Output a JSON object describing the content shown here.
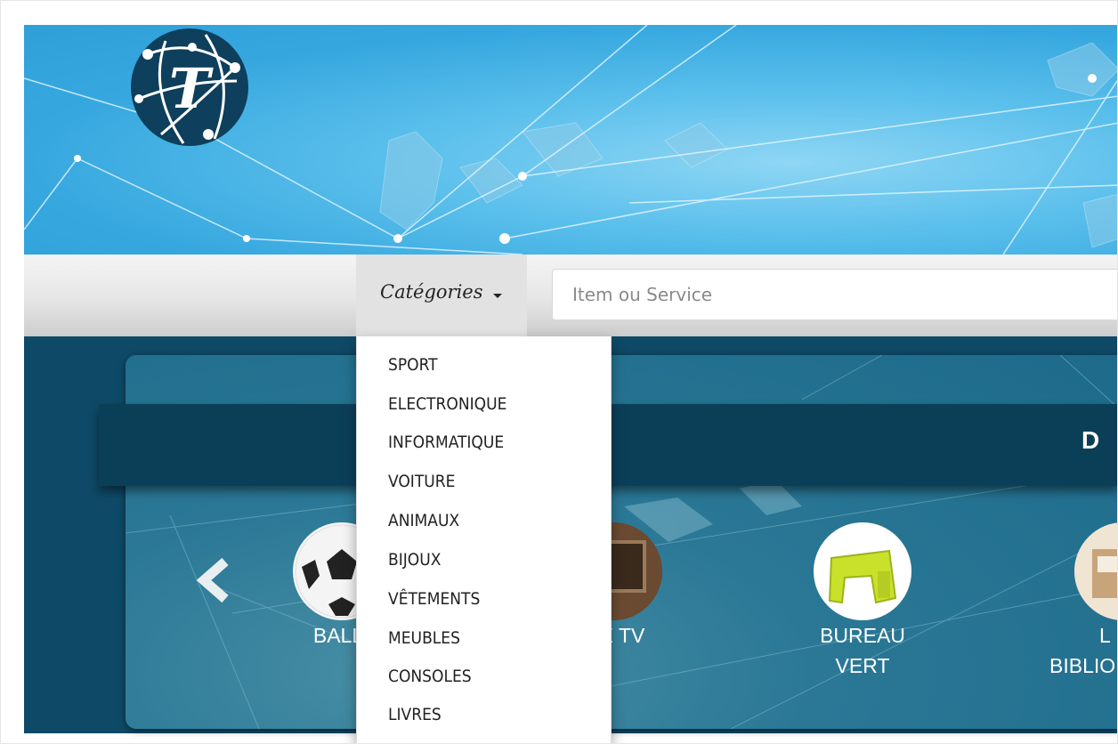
{
  "header": {
    "logo_letter": "T"
  },
  "search": {
    "categories_label": "Catégories",
    "placeholder": "Item ou Service"
  },
  "categories_menu": {
    "items": [
      "SPORT",
      "ELECTRONIQUE",
      "INFORMATIQUE",
      "VOITURE",
      "ANIMAUX",
      "BIJOUX",
      "VÊTEMENTS",
      "MEUBLES",
      "CONSOLES",
      "LIVRES"
    ]
  },
  "featured": {
    "title": "D",
    "products": [
      {
        "name_line1": "BALL",
        "name_line2": ""
      },
      {
        "name_line1": "E TV",
        "name_line2": ""
      },
      {
        "name_line1": "BUREAU",
        "name_line2": "VERT"
      },
      {
        "name_line1": "L",
        "name_line2": "BIBLIO"
      }
    ]
  },
  "colors": {
    "banner_blue": "#37a8df",
    "feature_dark": "#0e4a67",
    "logo_navy": "#0e3f5c"
  }
}
